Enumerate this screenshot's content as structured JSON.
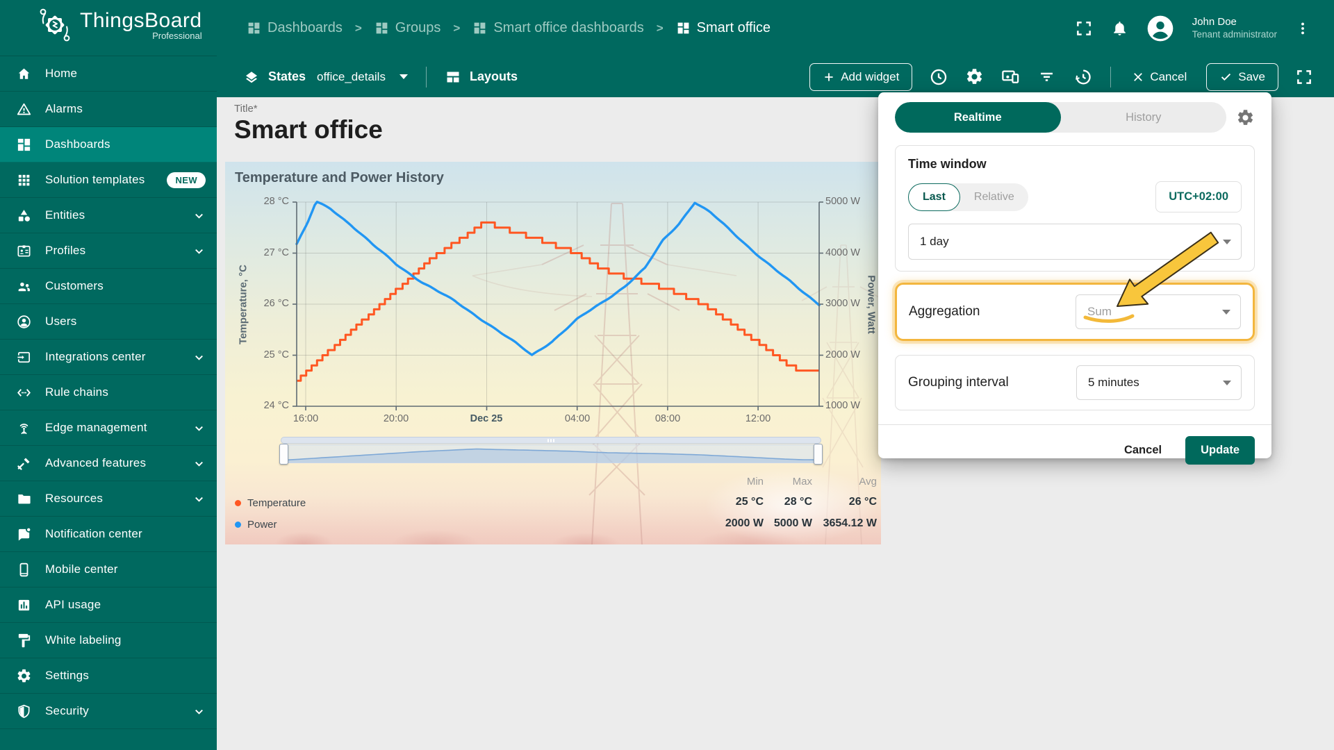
{
  "colors": {
    "teal": "#00695f",
    "teal_active": "#00857a",
    "teal_button": "#00695c",
    "chart_blue": "#2196f3",
    "chart_orange": "#ff5722",
    "annotation_yellow": "#f8c63c",
    "highlight_border": "#f3b63e"
  },
  "topbar": {
    "logo_title": "ThingsBoard",
    "logo_subtitle": "Professional",
    "breadcrumbs": [
      "Dashboards",
      "Groups",
      "Smart office dashboards",
      "Smart office"
    ],
    "user_name": "John Doe",
    "user_role": "Tenant administrator"
  },
  "toolbar": {
    "states_label": "States",
    "states_value": "office_details",
    "layouts_label": "Layouts",
    "add_widget_label": "Add widget",
    "cancel_label": "Cancel",
    "save_label": "Save"
  },
  "sidebar": {
    "items": [
      {
        "label": "Home",
        "icon": "home"
      },
      {
        "label": "Alarms",
        "icon": "alarms"
      },
      {
        "label": "Dashboards",
        "icon": "dashboards",
        "active": true
      },
      {
        "label": "Solution templates",
        "icon": "solution-templates",
        "badge": "NEW"
      },
      {
        "label": "Entities",
        "icon": "entities",
        "expandable": true
      },
      {
        "label": "Profiles",
        "icon": "profiles",
        "expandable": true
      },
      {
        "label": "Customers",
        "icon": "customers"
      },
      {
        "label": "Users",
        "icon": "users"
      },
      {
        "label": "Integrations center",
        "icon": "integrations",
        "expandable": true
      },
      {
        "label": "Rule chains",
        "icon": "rule-chains"
      },
      {
        "label": "Edge management",
        "icon": "edge",
        "expandable": true
      },
      {
        "label": "Advanced features",
        "icon": "advanced",
        "expandable": true
      },
      {
        "label": "Resources",
        "icon": "resources",
        "expandable": true
      },
      {
        "label": "Notification center",
        "icon": "notification"
      },
      {
        "label": "Mobile center",
        "icon": "mobile"
      },
      {
        "label": "API usage",
        "icon": "api-usage"
      },
      {
        "label": "White labeling",
        "icon": "white-labeling"
      },
      {
        "label": "Settings",
        "icon": "settings"
      },
      {
        "label": "Security",
        "icon": "security",
        "expandable": true
      }
    ]
  },
  "dashboard": {
    "title_label": "Title*",
    "title": "Smart office"
  },
  "chart_data": {
    "type": "line",
    "title": "Temperature and Power History",
    "t_span": 23.1,
    "x_ticks": [
      {
        "label": "16:00",
        "t": 0.4
      },
      {
        "label": "20:00",
        "t": 4.4
      },
      {
        "label": "Dec 25",
        "t": 8.4,
        "bold": true
      },
      {
        "label": "04:00",
        "t": 12.4
      },
      {
        "label": "08:00",
        "t": 16.4
      },
      {
        "label": "12:00",
        "t": 20.4
      }
    ],
    "y_left": {
      "label": "Temperature, °C",
      "min": 24,
      "max": 28,
      "tick_values": [
        28,
        27,
        26,
        25,
        24
      ],
      "tick_labels": [
        "28 °C",
        "27 °C",
        "26 °C",
        "25 °C",
        "24 °C"
      ]
    },
    "y_right": {
      "label": "Power, Watt",
      "min": 1000,
      "max": 5000,
      "tick_values": [
        5000,
        4000,
        3000,
        2000,
        1000
      ],
      "tick_labels": [
        "5000 W",
        "4000 W",
        "3000 W",
        "2000 W",
        "1000 W"
      ]
    },
    "series": [
      {
        "name": "Temperature",
        "axis": "left",
        "style": "step",
        "color": "#ff5722",
        "points": [
          [
            0,
            24.5
          ],
          [
            1,
            24.9
          ],
          [
            2,
            25.3
          ],
          [
            3,
            25.7
          ],
          [
            4,
            26.1
          ],
          [
            5,
            26.5
          ],
          [
            6,
            26.9
          ],
          [
            7,
            27.2
          ],
          [
            8,
            27.5
          ],
          [
            8.36,
            27.62
          ],
          [
            9,
            27.5
          ],
          [
            10.5,
            27.3
          ],
          [
            12.4,
            27.0
          ],
          [
            13.3,
            26.75
          ],
          [
            14,
            26.6
          ],
          [
            15.2,
            26.45
          ],
          [
            16.4,
            26.3
          ],
          [
            18,
            26.0
          ],
          [
            19,
            25.7
          ],
          [
            20.4,
            25.25
          ],
          [
            21.6,
            24.85
          ],
          [
            22.4,
            24.68
          ],
          [
            23.1,
            24.65
          ]
        ]
      },
      {
        "name": "Power",
        "axis": "right",
        "style": "smooth",
        "color": "#2196f3",
        "points": [
          [
            0,
            4180
          ],
          [
            0.45,
            4550
          ],
          [
            0.86,
            5000
          ],
          [
            1.5,
            4870
          ],
          [
            2.4,
            4560
          ],
          [
            3.4,
            4150
          ],
          [
            4.4,
            3780
          ],
          [
            5.6,
            3420
          ],
          [
            7,
            3050
          ],
          [
            8.4,
            2640
          ],
          [
            9.6,
            2260
          ],
          [
            10.4,
            2000
          ],
          [
            11.3,
            2280
          ],
          [
            12.4,
            2700
          ],
          [
            13.4,
            3000
          ],
          [
            14.5,
            3350
          ],
          [
            15.4,
            3700
          ],
          [
            16.2,
            4250
          ],
          [
            16.9,
            4580
          ],
          [
            17.6,
            5000
          ],
          [
            18.3,
            4790
          ],
          [
            19.2,
            4430
          ],
          [
            20.2,
            4040
          ],
          [
            21.2,
            3660
          ],
          [
            22.2,
            3300
          ],
          [
            23.1,
            3000
          ]
        ]
      }
    ],
    "stats": {
      "headers": [
        "Min",
        "Max",
        "Avg"
      ],
      "rows": [
        {
          "label": "Temperature",
          "dot_color": "#ff5722",
          "min": "25 °C",
          "max": "28 °C",
          "avg": "26 °C"
        },
        {
          "label": "Power",
          "dot_color": "#2196f3",
          "min": "2000 W",
          "max": "5000 W",
          "avg": "3654.12 W"
        }
      ]
    },
    "legend_position": "bottom-left",
    "grid": true
  },
  "popup": {
    "tab_realtime": "Realtime",
    "tab_history": "History",
    "time_window": {
      "title": "Time window",
      "toggle_last": "Last",
      "toggle_relative": "Relative",
      "timezone": "UTC+02:00",
      "interval_value": "1 day"
    },
    "aggregation": {
      "label": "Aggregation",
      "value": "Sum"
    },
    "grouping": {
      "label": "Grouping interval",
      "value": "5 minutes"
    },
    "cancel_label": "Cancel",
    "update_label": "Update"
  }
}
